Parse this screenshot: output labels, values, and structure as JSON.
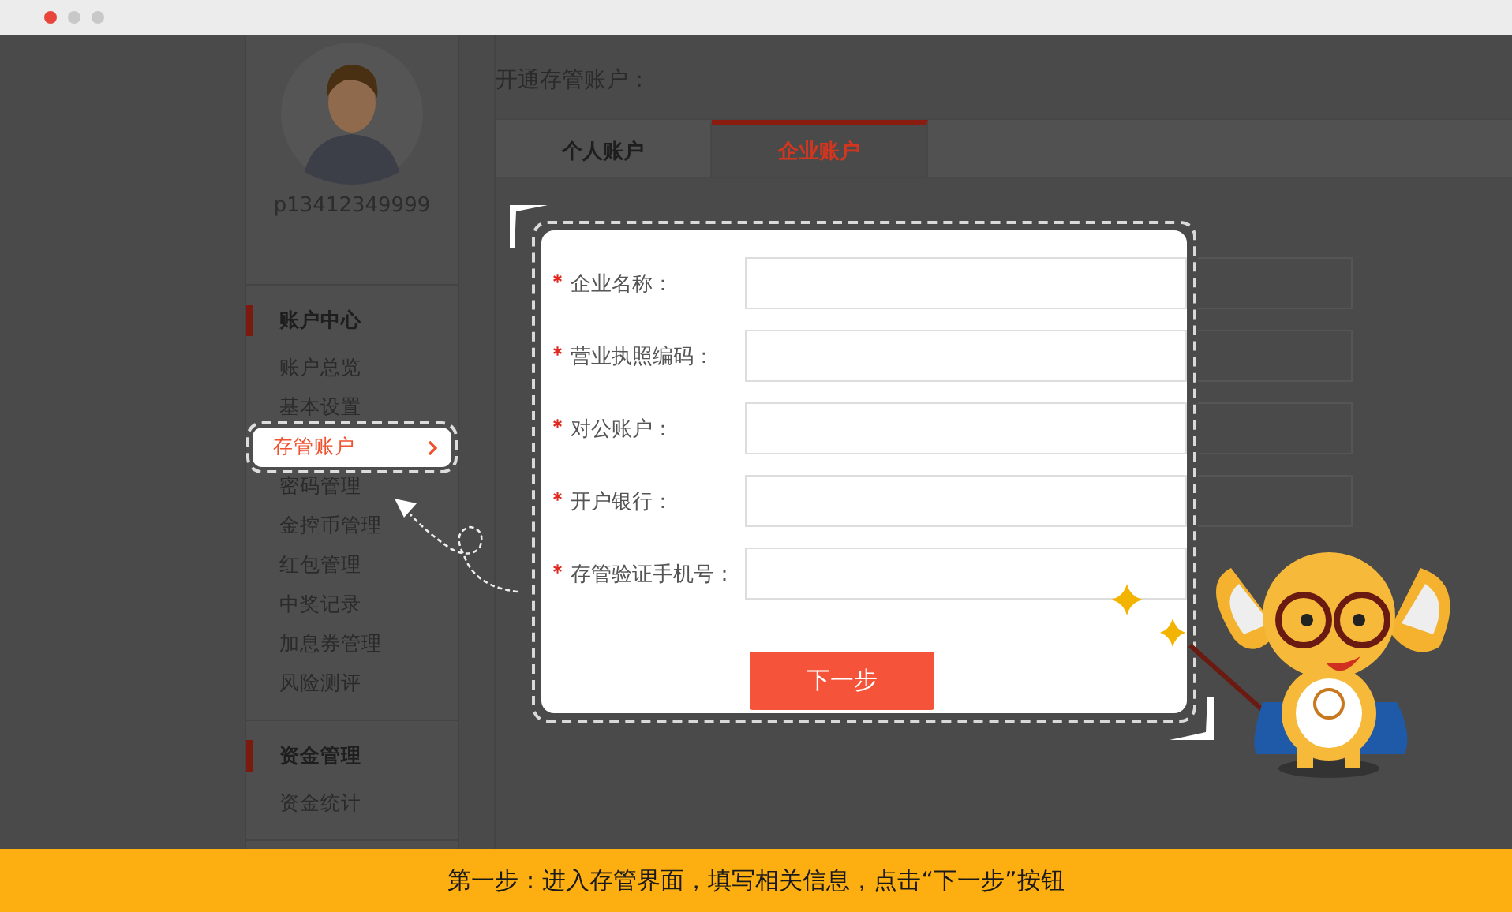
{
  "window": {
    "controls": [
      {
        "kind": "close"
      },
      {
        "kind": "minimize"
      },
      {
        "kind": "maximize"
      }
    ]
  },
  "sidebar": {
    "username": "p13412349999",
    "sections": [
      {
        "title": "账户中心",
        "items": [
          {
            "label": "账户总览",
            "selected": false
          },
          {
            "label": "基本设置",
            "selected": false
          },
          {
            "label": "存管账户",
            "selected": true
          },
          {
            "label": "密码管理",
            "selected": false
          },
          {
            "label": "金控币管理",
            "selected": false
          },
          {
            "label": "红包管理",
            "selected": false
          },
          {
            "label": "中奖记录",
            "selected": false
          },
          {
            "label": "加息券管理",
            "selected": false
          },
          {
            "label": "风险测评",
            "selected": false
          }
        ]
      },
      {
        "title": "资金管理",
        "items": [
          {
            "label": "资金统计",
            "selected": false
          }
        ]
      }
    ]
  },
  "page_title": "开通存管账户：",
  "tabs": [
    {
      "label": "个人账户",
      "selected": false
    },
    {
      "label": "企业账户",
      "selected": true
    }
  ],
  "form": {
    "fields": [
      {
        "label": "企业名称：",
        "required": true
      },
      {
        "label": "营业执照编码：",
        "required": true
      },
      {
        "label": "对公账户：",
        "required": true
      },
      {
        "label": "开户银行：",
        "required": true
      },
      {
        "label": "存管验证手机号：",
        "required": true
      }
    ],
    "submit": "下一步"
  },
  "caption": "第一步：进入存管界面，填写相关信息，点击“下一步”按钮"
}
